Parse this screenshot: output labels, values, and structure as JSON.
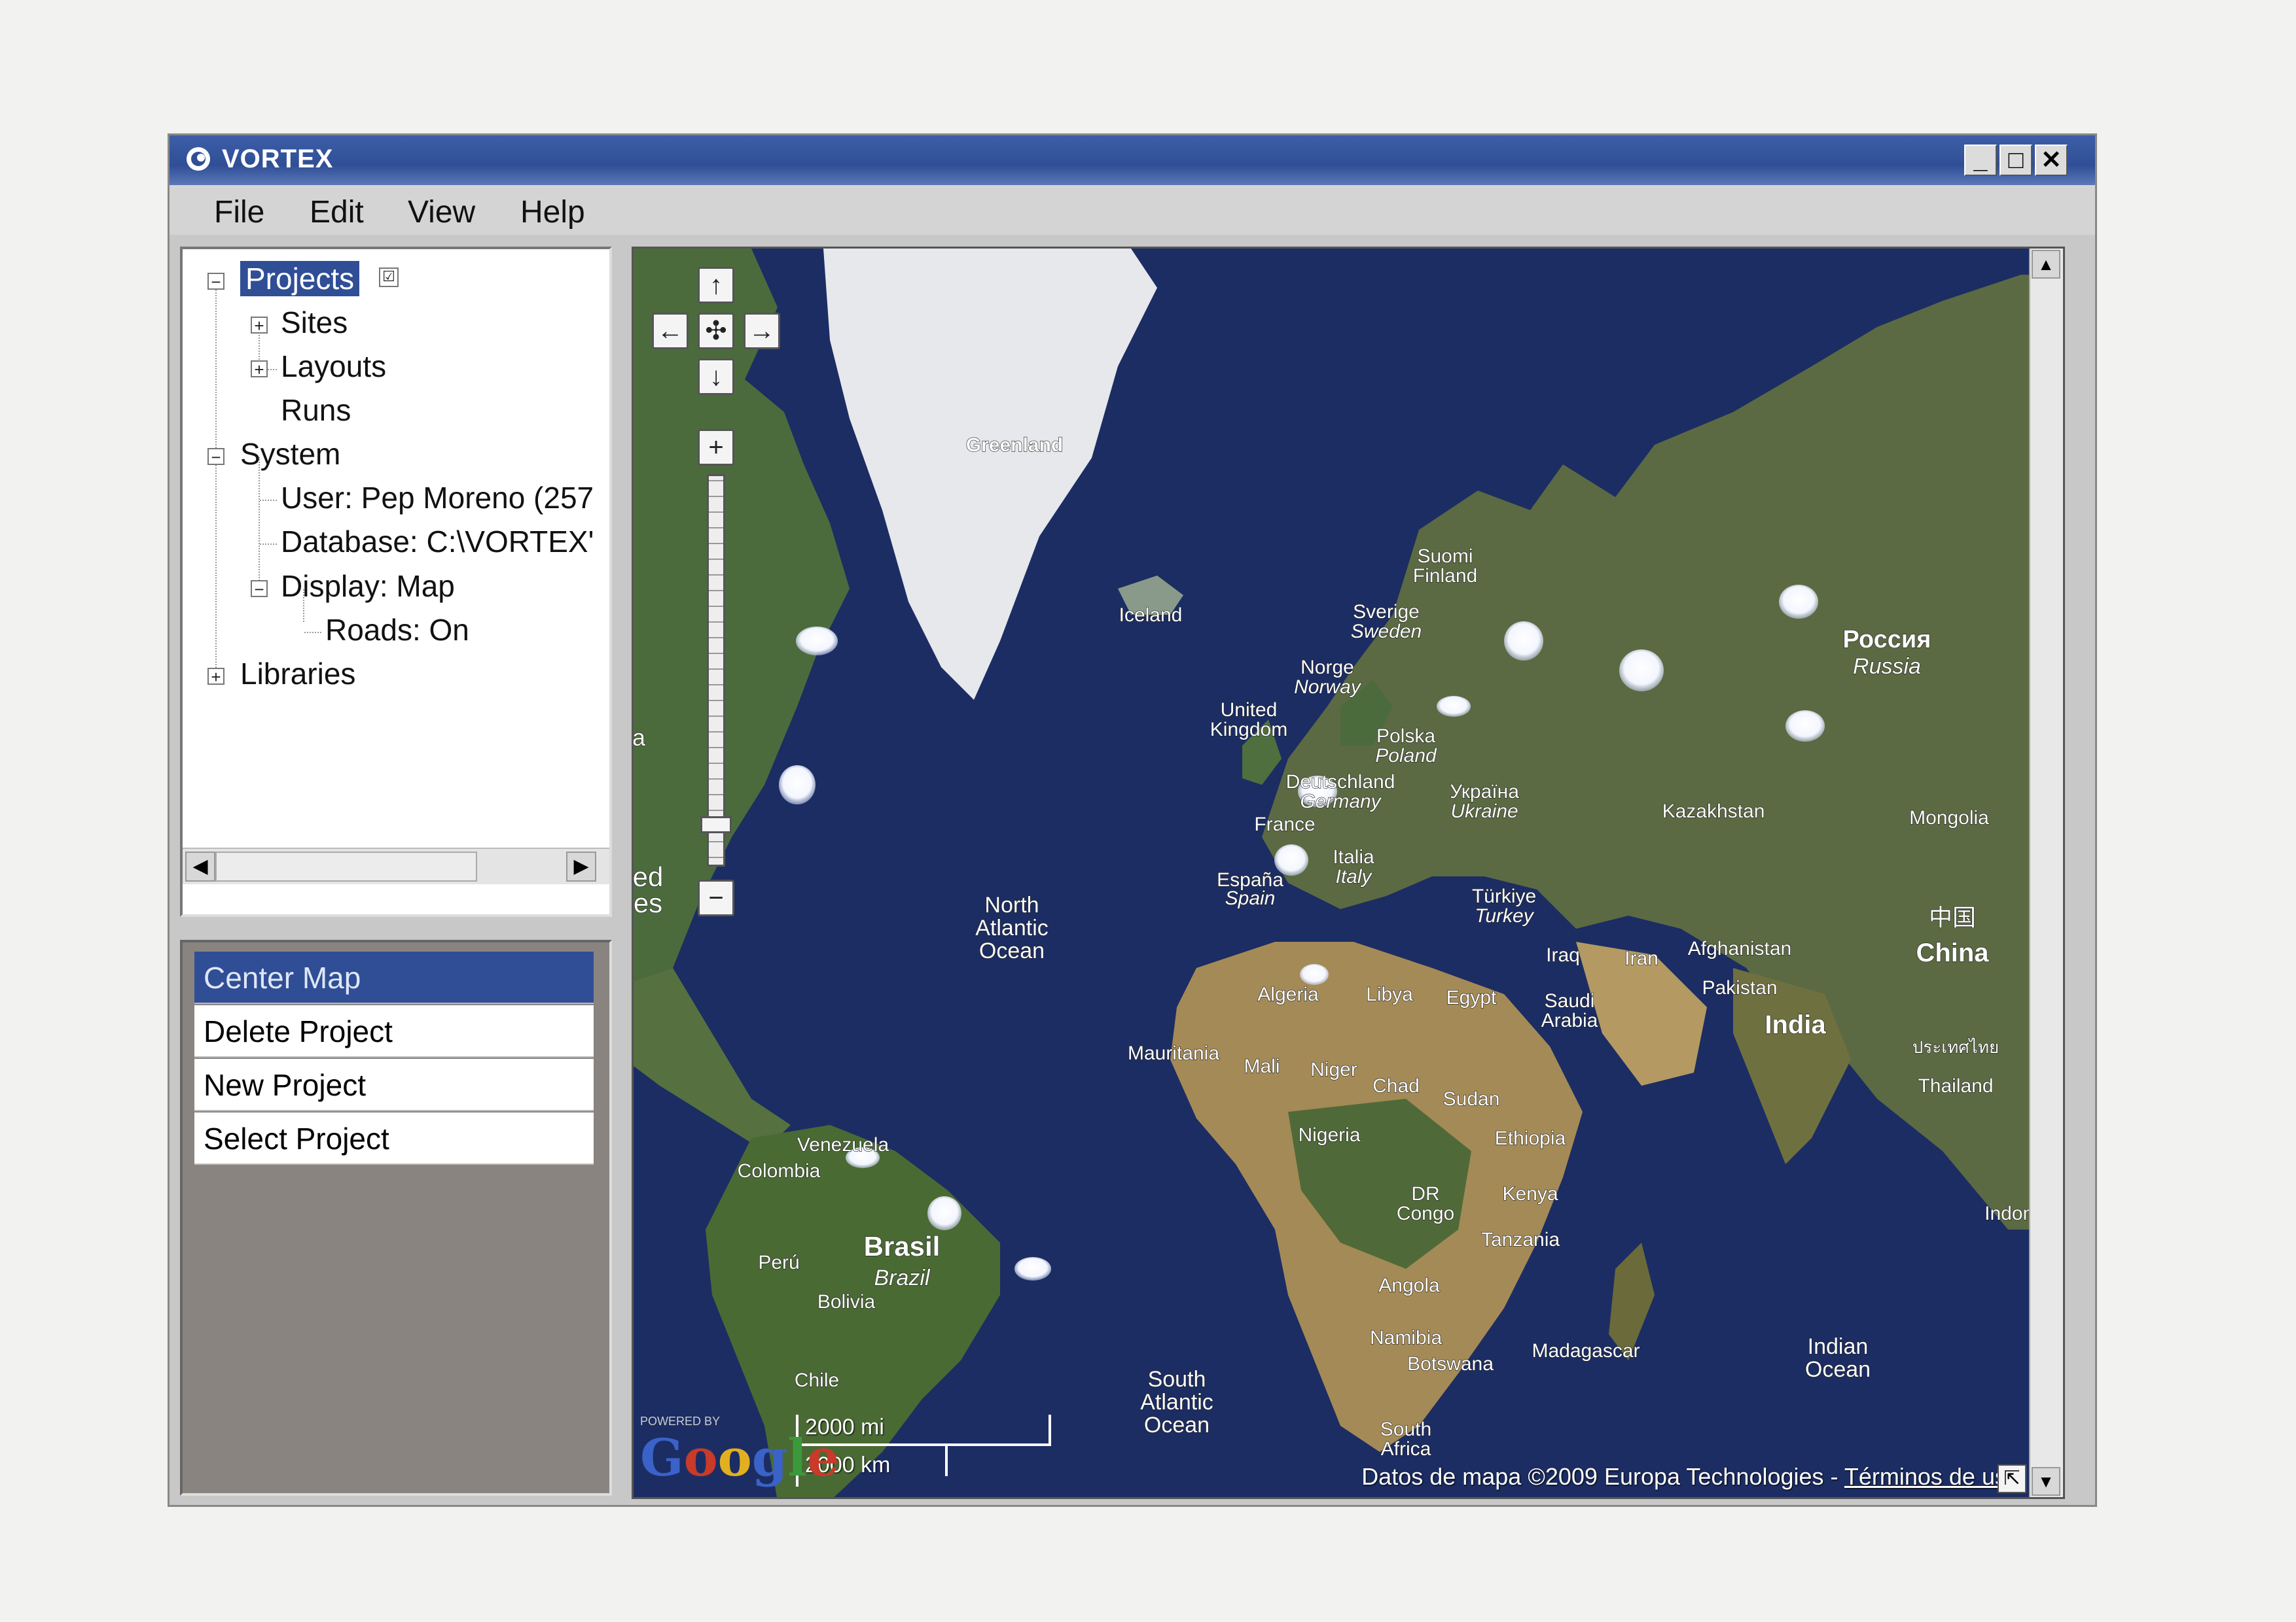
{
  "window": {
    "title": "VORTEX",
    "controls": [
      "_",
      "□",
      "✕"
    ]
  },
  "menu": [
    "File",
    "Edit",
    "View",
    "Help"
  ],
  "tree": {
    "projects": "Projects",
    "sites": "Sites",
    "layouts": "Layouts",
    "runs": "Runs",
    "system": "System",
    "user": "User: Pep Moreno (257",
    "database": "Database: C:\\VORTEX'",
    "display": "Display: Map",
    "roads": "Roads: On",
    "libraries": "Libraries"
  },
  "actions": [
    "Center Map",
    "Delete Project",
    "New Project",
    "Select Project"
  ],
  "map": {
    "labels": {
      "greenland": "Greenland",
      "iceland": "Iceland",
      "suomi": "Suomi",
      "finland": "Finland",
      "sverige": "Sverige",
      "sweden": "Sweden",
      "norge": "Norge",
      "norway": "Norway",
      "rossiya": "Россия",
      "russia": "Russia",
      "uk1": "United",
      "uk2": "Kingdom",
      "polska": "Polska",
      "poland": "Poland",
      "deutschland": "Deutschland",
      "germany": "Germany",
      "ukraina": "Україна",
      "ukraine": "Ukraine",
      "france": "France",
      "kazakhstan": "Kazakhstan",
      "mongolia": "Mongolia",
      "espana": "España",
      "spain": "Spain",
      "italia": "Italia",
      "italy": "Italy",
      "turkiye": "Türkiye",
      "turkey": "Turkey",
      "nao1": "North",
      "nao2": "Atlantic",
      "nao3": "Ocean",
      "iraq": "Iraq",
      "iran": "Iran",
      "afghanistan": "Afghanistan",
      "pakistan": "Pakistan",
      "china_cn": "中国",
      "china": "China",
      "india": "India",
      "algeria": "Algeria",
      "libya": "Libya",
      "egypt": "Egypt",
      "saudi1": "Saudi",
      "saudi2": "Arabia",
      "mauritania": "Mauritania",
      "mali": "Mali",
      "niger": "Niger",
      "chad": "Chad",
      "sudan": "Sudan",
      "thai_th": "ประเทศไทย",
      "thailand": "Thailand",
      "venezuela": "Venezuela",
      "colombia": "Colombia",
      "nigeria": "Nigeria",
      "ethiopia": "Ethiopia",
      "brasil": "Brasil",
      "brazil": "Brazil",
      "dr": "DR",
      "congo": "Congo",
      "kenya": "Kenya",
      "peru": "Perú",
      "tanzania": "Tanzania",
      "indonesia": "Indone",
      "bolivia": "Bolivia",
      "angola": "Angola",
      "namibia": "Namibia",
      "madagascar": "Madagascar",
      "indian1": "Indian",
      "indian2": "Ocean",
      "botswana": "Botswana",
      "chile": "Chile",
      "sao1": "South",
      "sao2": "Atlantic",
      "sao3": "Ocean",
      "sa1": "South",
      "sa2": "Africa",
      "edge1": "ed",
      "edge2": "es",
      "edge3": "a"
    },
    "scale_mi": "2000 mi",
    "scale_km": "2000 km",
    "powered_by": "POWERED BY",
    "google": "Google",
    "copyright": "Datos de mapa ©2009 Europa Technologies - ",
    "terms": "Términos de uso"
  }
}
